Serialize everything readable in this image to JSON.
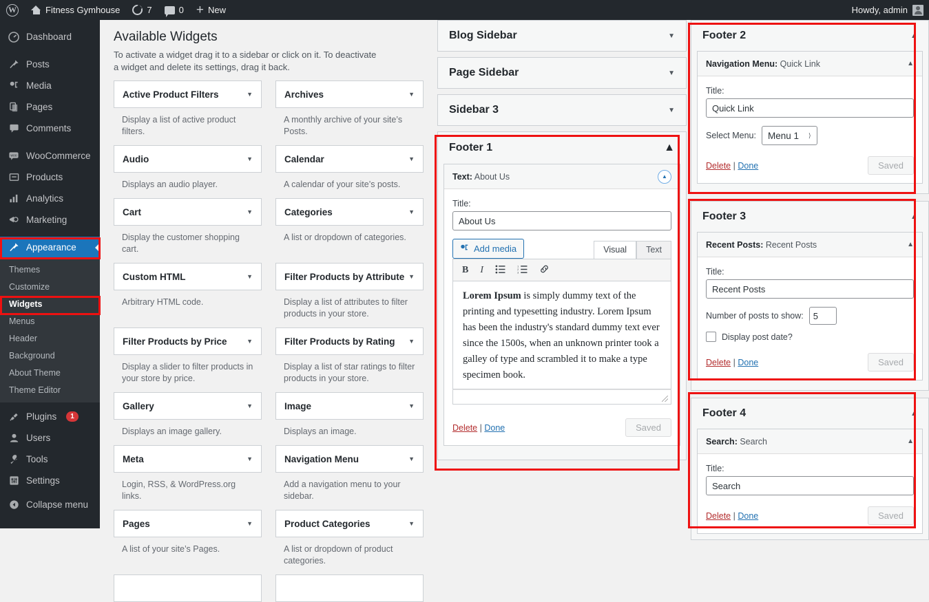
{
  "adminbar": {
    "logo_icon": "wordpress-logo-icon",
    "site_name": "Fitness Gymhouse",
    "home_icon": "home-icon",
    "updates_icon": "updates-icon",
    "updates_count": "7",
    "comments_icon": "comments-icon",
    "comments_count": "0",
    "new_icon": "plus-icon",
    "new_label": "New",
    "howdy": "Howdy, admin",
    "avatar_icon": "avatar-icon"
  },
  "sidebar": {
    "items": [
      {
        "label": "Dashboard",
        "icon": "dashboard-icon"
      },
      {
        "label": "Posts",
        "icon": "pin-icon"
      },
      {
        "label": "Media",
        "icon": "media-icon"
      },
      {
        "label": "Pages",
        "icon": "pages-icon"
      },
      {
        "label": "Comments",
        "icon": "comment-icon"
      },
      {
        "label": "WooCommerce",
        "icon": "woocommerce-icon"
      },
      {
        "label": "Products",
        "icon": "products-icon"
      },
      {
        "label": "Analytics",
        "icon": "analytics-icon"
      },
      {
        "label": "Marketing",
        "icon": "megaphone-icon"
      },
      {
        "label": "Appearance",
        "icon": "brush-icon"
      }
    ],
    "appearance_submenu": [
      {
        "label": "Themes"
      },
      {
        "label": "Customize"
      },
      {
        "label": "Widgets"
      },
      {
        "label": "Menus"
      },
      {
        "label": "Header"
      },
      {
        "label": "Background"
      },
      {
        "label": "About Theme"
      },
      {
        "label": "Theme Editor"
      }
    ],
    "bottom_items": [
      {
        "label": "Plugins",
        "icon": "plug-icon",
        "badge": "1"
      },
      {
        "label": "Users",
        "icon": "user-icon",
        "badge": ""
      },
      {
        "label": "Tools",
        "icon": "wrench-icon",
        "badge": ""
      },
      {
        "label": "Settings",
        "icon": "settings-icon",
        "badge": ""
      },
      {
        "label": "Collapse menu",
        "icon": "collapse-icon",
        "badge": ""
      }
    ],
    "accent_color": "#1b75bb",
    "highlight_color": "#ee1111"
  },
  "available": {
    "heading": "Available Widgets",
    "intro": "To activate a widget drag it to a sidebar or click on it. To deactivate a widget and delete its settings, drag it back.",
    "widgets": [
      {
        "name": "Active Product Filters",
        "desc": "Display a list of active product filters."
      },
      {
        "name": "Archives",
        "desc": "A monthly archive of your site’s Posts."
      },
      {
        "name": "Audio",
        "desc": "Displays an audio player."
      },
      {
        "name": "Calendar",
        "desc": "A calendar of your site’s posts."
      },
      {
        "name": "Cart",
        "desc": "Display the customer shopping cart."
      },
      {
        "name": "Categories",
        "desc": "A list or dropdown of categories."
      },
      {
        "name": "Custom HTML",
        "desc": "Arbitrary HTML code."
      },
      {
        "name": "Filter Products by Attribute",
        "desc": "Display a list of attributes to filter products in your store."
      },
      {
        "name": "Filter Products by Price",
        "desc": "Display a slider to filter products in your store by price."
      },
      {
        "name": "Filter Products by Rating",
        "desc": "Display a list of star ratings to filter products in your store."
      },
      {
        "name": "Gallery",
        "desc": "Displays an image gallery."
      },
      {
        "name": "Image",
        "desc": "Displays an image."
      },
      {
        "name": "Meta",
        "desc": "Login, RSS, & WordPress.org links."
      },
      {
        "name": "Navigation Menu",
        "desc": "Add a navigation menu to your sidebar."
      },
      {
        "name": "Pages",
        "desc": "A list of your site’s Pages."
      },
      {
        "name": "Product Categories",
        "desc": "A list or dropdown of product categories."
      }
    ]
  },
  "sidebars": {
    "collapsed": [
      {
        "title": "Blog Sidebar",
        "caret": "▼"
      },
      {
        "title": "Page Sidebar",
        "caret": "▼"
      },
      {
        "title": "Sidebar 3",
        "caret": "▼"
      }
    ],
    "footer1": {
      "title": "Footer 1",
      "caret": "▲",
      "widget": {
        "type_label": "Text:",
        "instance_label": "About Us",
        "toggle_icon": "chevron-up-icon",
        "title_label": "Title:",
        "title_value": "About Us",
        "add_media_label": "Add media",
        "add_media_icon": "media-icon",
        "tabs": [
          "Visual",
          "Text"
        ],
        "active_tab": "Visual",
        "toolbar_icons": [
          "bold-icon",
          "italic-icon",
          "bulleted-list-icon",
          "numbered-list-icon",
          "link-icon"
        ],
        "toolbar_glyphs": [
          "B",
          "I",
          "☰",
          "☰",
          "🔗"
        ],
        "content_bold": "Lorem Ipsum",
        "content_rest": " is simply dummy text of the printing and typesetting industry. Lorem Ipsum has been the industry's standard dummy text ever since the 1500s, when an unknown printer took a galley of type and scrambled it to make a type specimen book.",
        "delete_label": "Delete",
        "separator": "|",
        "done_label": "Done",
        "saved_label": "Saved"
      }
    }
  },
  "footers": [
    {
      "title": "Footer 2",
      "caret": "▲",
      "widget_type": "Navigation Menu:",
      "widget_name": "Quick Link",
      "toggle_icon": "chevron-up-icon",
      "title_label": "Title:",
      "title_value": "Quick Link",
      "select_label": "Select Menu:",
      "select_value": "Menu 1",
      "select_options": [
        "Menu 1"
      ],
      "delete_label": "Delete",
      "separator": "|",
      "done_label": "Done",
      "saved_label": "Saved"
    },
    {
      "title": "Footer 3",
      "caret": "▲",
      "widget_type": "Recent Posts:",
      "widget_name": "Recent Posts",
      "toggle_icon": "chevron-up-icon",
      "title_label": "Title:",
      "title_value": "Recent Posts",
      "number_label": "Number of posts to show:",
      "number_value": "5",
      "checkbox_label": "Display post date?",
      "checkbox_checked": false,
      "delete_label": "Delete",
      "separator": "|",
      "done_label": "Done",
      "saved_label": "Saved"
    },
    {
      "title": "Footer 4",
      "caret": "▲",
      "widget_type": "Search:",
      "widget_name": "Search",
      "toggle_icon": "chevron-up-icon",
      "title_label": "Title:",
      "title_value": "Search",
      "delete_label": "Delete",
      "separator": "|",
      "done_label": "Done",
      "saved_label": "Saved"
    }
  ]
}
